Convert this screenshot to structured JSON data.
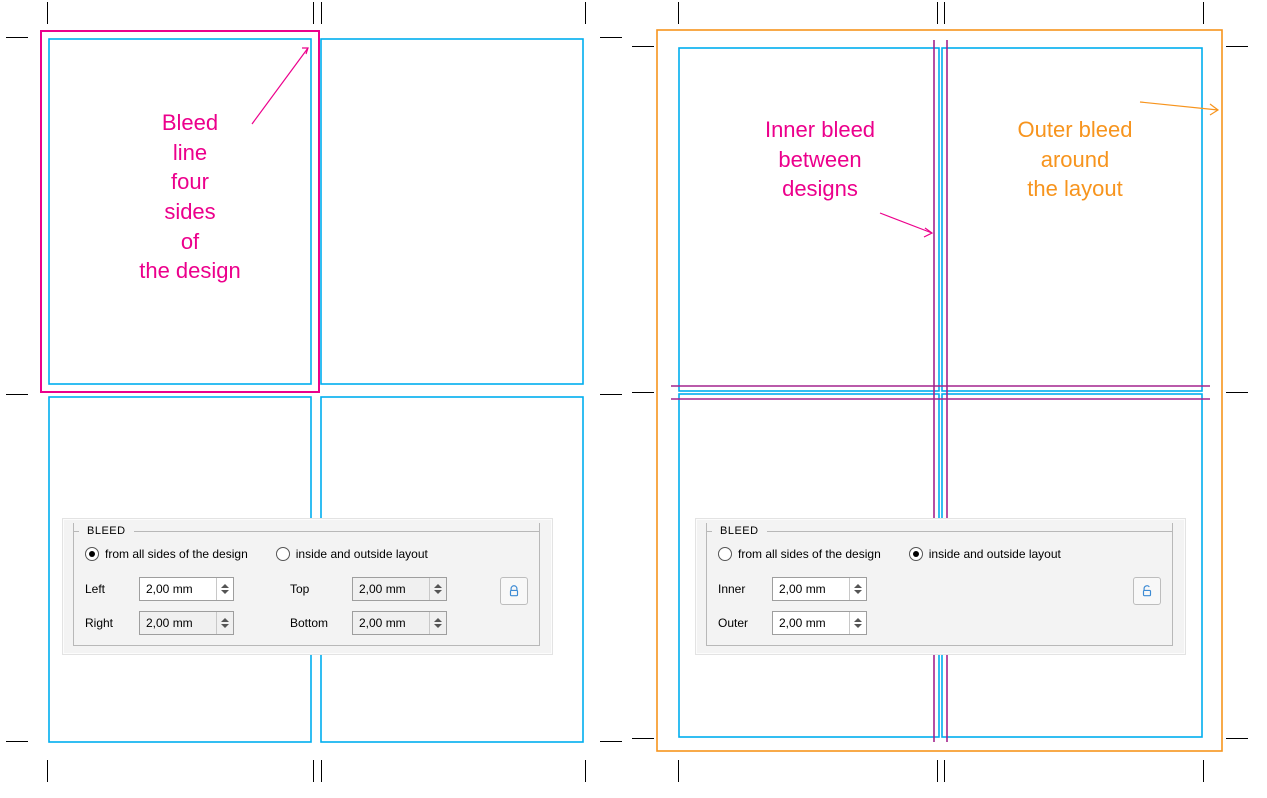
{
  "colors": {
    "cyan": "#00aeef",
    "magenta": "#ec008c",
    "purple": "#a3238e",
    "orange": "#f7941d"
  },
  "left_diagram": {
    "annotation": "Bleed\nline\nfour\nsides\nof\nthe design"
  },
  "right_diagram": {
    "annotation_inner": "Inner bleed\nbetween\ndesigns",
    "annotation_outer": "Outer bleed\naround\nthe layout"
  },
  "panel_left": {
    "title": "BLEED",
    "radio1": "from all sides of the design",
    "radio2": "inside and outside layout",
    "selected": 1,
    "fields": [
      {
        "label": "Left",
        "value": "2,00 mm",
        "enabled": true
      },
      {
        "label": "Right",
        "value": "2,00 mm",
        "enabled": false
      },
      {
        "label": "Top",
        "value": "2,00 mm",
        "enabled": false
      },
      {
        "label": "Bottom",
        "value": "2,00 mm",
        "enabled": false
      }
    ],
    "lock_state": "locked"
  },
  "panel_right": {
    "title": "BLEED",
    "radio1": "from all sides of the design",
    "radio2": "inside and outside layout",
    "selected": 2,
    "fields": [
      {
        "label": "Inner",
        "value": "2,00 mm",
        "enabled": true
      },
      {
        "label": "Outer",
        "value": "2,00 mm",
        "enabled": true
      }
    ],
    "lock_state": "unlocked"
  }
}
